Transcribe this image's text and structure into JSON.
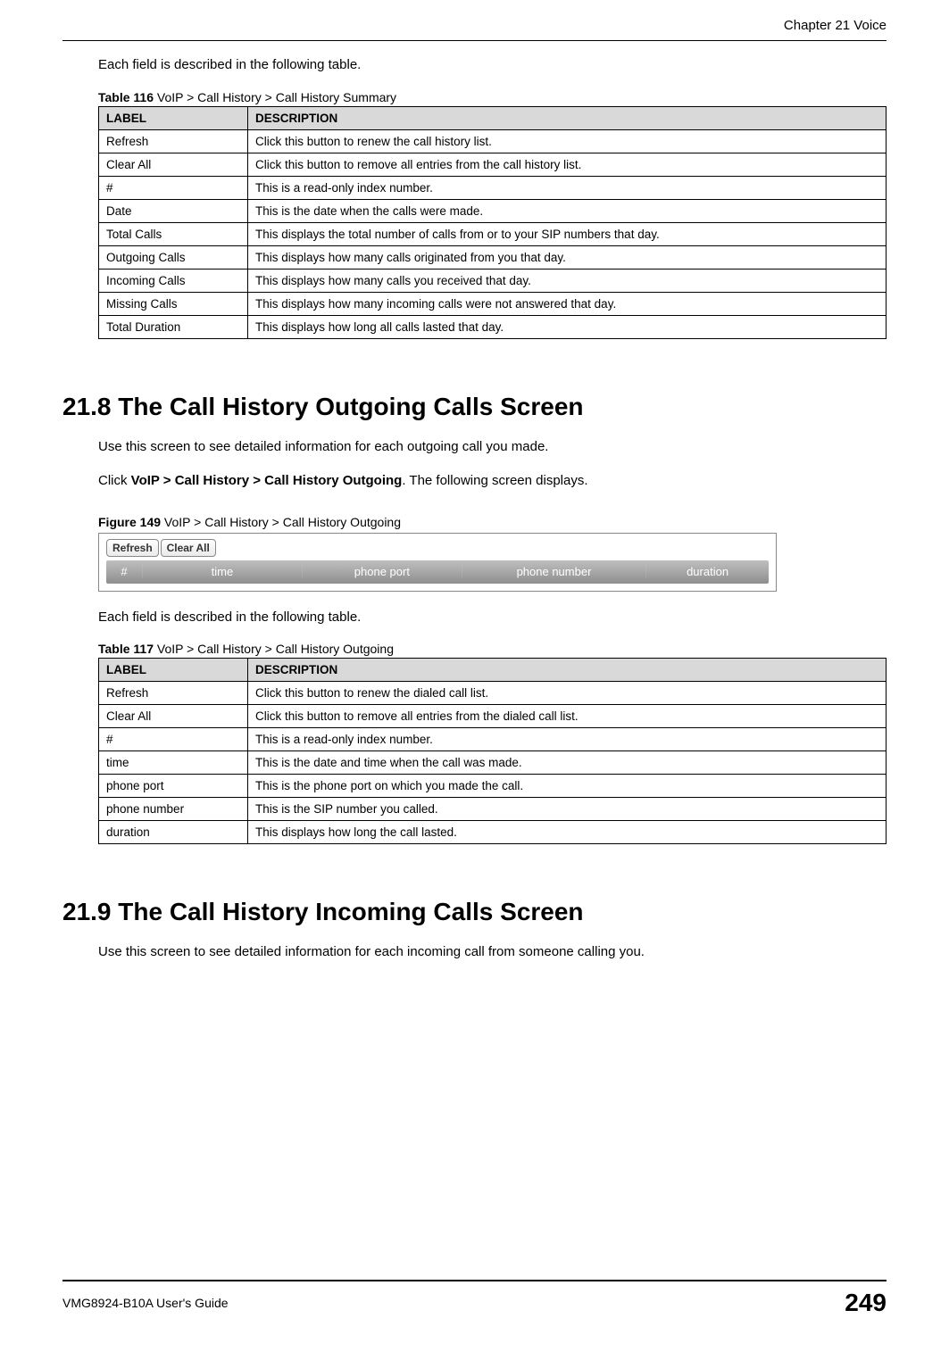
{
  "header": {
    "chapter": "Chapter 21 Voice"
  },
  "intro1": "Each field is described in the following table.",
  "table116": {
    "caption_bold": "Table 116",
    "caption_rest": "   VoIP > Call History > Call History Summary",
    "header_label": "LABEL",
    "header_desc": "DESCRIPTION",
    "rows": [
      {
        "label": "Refresh",
        "desc": "Click this button to renew the call history list."
      },
      {
        "label": "Clear All",
        "desc": "Click this button to remove all entries from the call history list."
      },
      {
        "label": "#",
        "desc": "This is a read-only index number."
      },
      {
        "label": "Date",
        "desc": "This is the date when the calls were made."
      },
      {
        "label": "Total Calls",
        "desc": "This displays the total number of calls from or to your SIP numbers that day."
      },
      {
        "label": "Outgoing Calls",
        "desc": "This displays how many calls originated from you that day."
      },
      {
        "label": "Incoming Calls",
        "desc": "This displays how many calls you received that day."
      },
      {
        "label": "Missing Calls",
        "desc": "This displays how many incoming calls were not answered that day."
      },
      {
        "label": "Total Duration",
        "desc": "This displays how long all calls lasted that day."
      }
    ]
  },
  "section218": {
    "heading": "21.8  The Call History Outgoing Calls Screen",
    "para1": "Use this screen to see detailed information for each outgoing call you made.",
    "para2_a": "Click ",
    "para2_bold": "VoIP > Call History > Call History Outgoing",
    "para2_b": ". The following screen displays."
  },
  "figure149": {
    "caption_bold": "Figure 149",
    "caption_rest": "   VoIP > Call History > Call History Outgoing",
    "btn_refresh": "Refresh",
    "btn_clearall": "Clear All",
    "col_hash": "#",
    "col_time": "time",
    "col_port": "phone port",
    "col_phone": "phone number",
    "col_dur": "duration"
  },
  "intro2": "Each field is described in the following table.",
  "table117": {
    "caption_bold": "Table 117",
    "caption_rest": "   VoIP > Call History > Call History Outgoing",
    "header_label": "LABEL",
    "header_desc": "DESCRIPTION",
    "rows": [
      {
        "label": "Refresh",
        "desc": "Click this button to renew the dialed call list."
      },
      {
        "label": "Clear All",
        "desc": "Click this button to remove all entries from the dialed call list."
      },
      {
        "label": "#",
        "desc": "This is a read-only index number."
      },
      {
        "label": "time",
        "desc": "This is the date and time when the call was made."
      },
      {
        "label": "phone port",
        "desc": "This is the phone port on which you made the call."
      },
      {
        "label": "phone number",
        "desc": "This is the SIP number you called."
      },
      {
        "label": "duration",
        "desc": "This displays how long the call lasted."
      }
    ]
  },
  "section219": {
    "heading": "21.9  The Call History Incoming Calls Screen",
    "para1": "Use this screen to see detailed information for each incoming call from someone calling you."
  },
  "footer": {
    "guide": "VMG8924-B10A User's Guide",
    "page": "249"
  }
}
